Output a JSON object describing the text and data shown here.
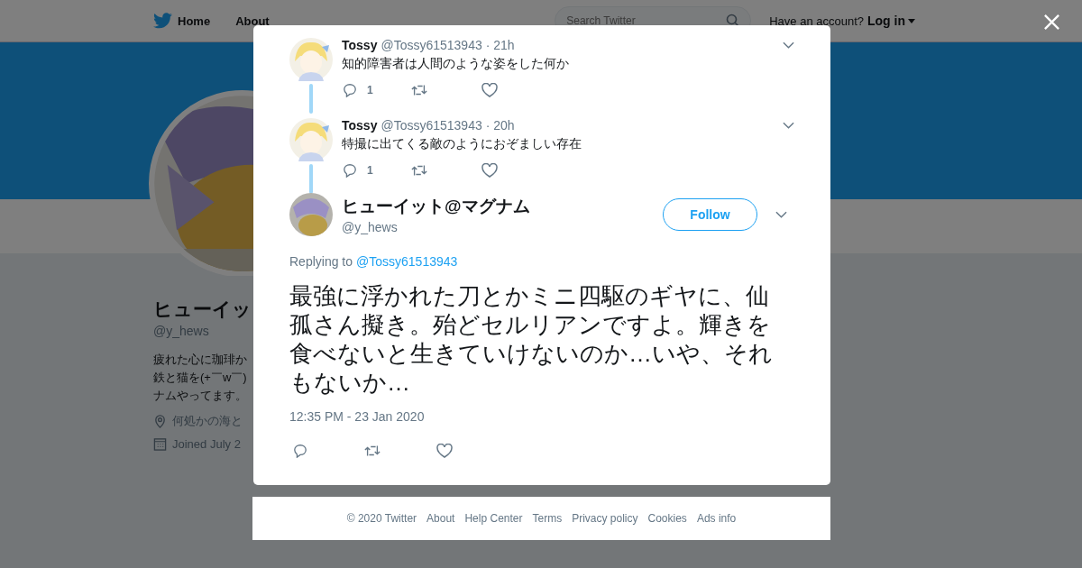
{
  "nav": {
    "items": [
      {
        "label": "Home"
      },
      {
        "label": "About"
      }
    ],
    "search": {
      "placeholder": "Search Twitter"
    },
    "account_prompt": "Have an account?",
    "login": "Log in"
  },
  "profile": {
    "name": "ヒューイッ",
    "handle": "@y_hews",
    "bio_lines": [
      "疲れた心に珈琲か",
      "鉄と猫を(+￣w￣)",
      "ナムやってます。"
    ],
    "location": "何処かの海と",
    "joined": "Joined July 2"
  },
  "thread": [
    {
      "name": "Tossy",
      "handle": "@Tossy61513943",
      "time": "· 21h",
      "text": "知的障害者は人間のような姿をした何か",
      "replies": "1"
    },
    {
      "name": "Tossy",
      "handle": "@Tossy61513943",
      "time": "· 20h",
      "text": "特撮に出てくる敵のようにおぞましい存在",
      "replies": "1"
    }
  ],
  "tweet": {
    "name": "ヒューイット@マグナム",
    "handle": "@y_hews",
    "follow": "Follow",
    "replying_to": "Replying to",
    "reply_handle": "@Tossy61513943",
    "text": "最強に浮かれた刀とかミニ四駆のギヤに、仙孤さん擬き。殆どセルリアンですよ。輝きを食べないと生きていけないのか…いや、それもないか…",
    "timestamp": "12:35 PM - 23 Jan 2020"
  },
  "footer": [
    "© 2020 Twitter",
    "About",
    "Help Center",
    "Terms",
    "Privacy policy",
    "Cookies",
    "Ads info"
  ]
}
